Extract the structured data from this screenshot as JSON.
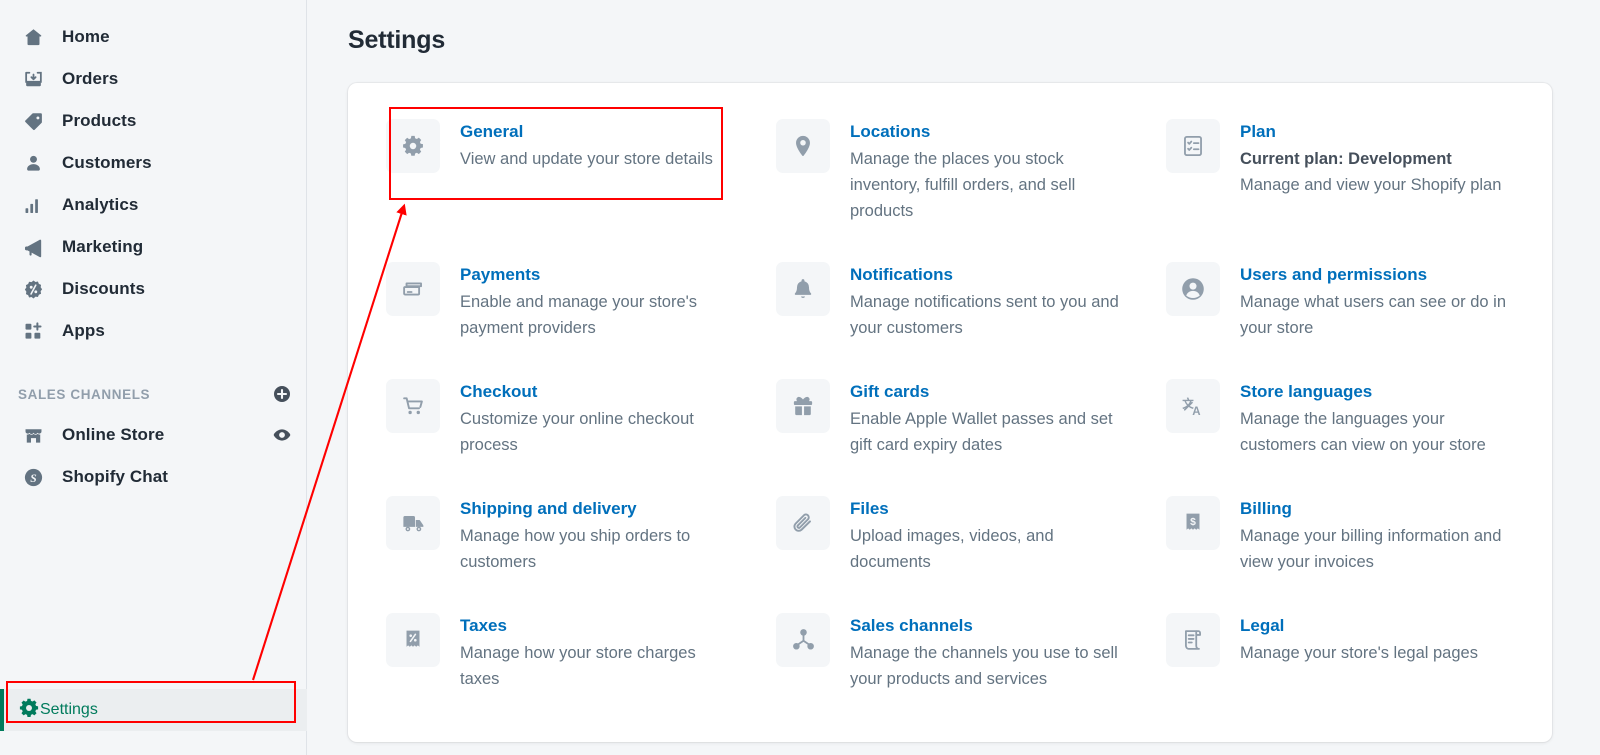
{
  "sidebar": {
    "items": [
      {
        "label": "Home",
        "icon": "home-icon"
      },
      {
        "label": "Orders",
        "icon": "orders-inbox-icon"
      },
      {
        "label": "Products",
        "icon": "product-tag-icon"
      },
      {
        "label": "Customers",
        "icon": "customer-person-icon"
      },
      {
        "label": "Analytics",
        "icon": "analytics-bars-icon"
      },
      {
        "label": "Marketing",
        "icon": "marketing-megaphone-icon"
      },
      {
        "label": "Discounts",
        "icon": "discount-percent-icon"
      },
      {
        "label": "Apps",
        "icon": "apps-grid-plus-icon"
      }
    ],
    "section": {
      "label": "SALES CHANNELS",
      "add_icon": "plus-circle-icon"
    },
    "channels": [
      {
        "label": "Online Store",
        "icon": "storefront-icon",
        "trailing_icon": "eye-icon"
      },
      {
        "label": "Shopify Chat",
        "icon": "shopify-badge-icon",
        "trailing_icon": ""
      }
    ],
    "settings": {
      "label": "Settings",
      "icon": "gear-icon",
      "active": true
    }
  },
  "main": {
    "page_title": "Settings",
    "settings_items": [
      {
        "title": "General",
        "strong": "",
        "sub": "View and update your store details",
        "icon": "gear-icon"
      },
      {
        "title": "Locations",
        "strong": "",
        "sub": "Manage the places you stock inventory, fulfill orders, and sell products",
        "icon": "location-pin-icon"
      },
      {
        "title": "Plan",
        "strong": "Current plan: Development",
        "sub": "Manage and view your Shopify plan",
        "icon": "checklist-clipboard-icon"
      },
      {
        "title": "Payments",
        "strong": "",
        "sub": "Enable and manage your store's payment providers",
        "icon": "payment-card-icon"
      },
      {
        "title": "Notifications",
        "strong": "",
        "sub": "Manage notifications sent to you and your customers",
        "icon": "bell-icon"
      },
      {
        "title": "Users and permissions",
        "strong": "",
        "sub": "Manage what users can see or do in your store",
        "icon": "user-circle-icon"
      },
      {
        "title": "Checkout",
        "strong": "",
        "sub": "Customize your online checkout process",
        "icon": "shopping-cart-icon"
      },
      {
        "title": "Gift cards",
        "strong": "",
        "sub": "Enable Apple Wallet passes and set gift card expiry dates",
        "icon": "gift-box-icon"
      },
      {
        "title": "Store languages",
        "strong": "",
        "sub": "Manage the languages your customers can view on your store",
        "icon": "language-translate-icon"
      },
      {
        "title": "Shipping and delivery",
        "strong": "",
        "sub": "Manage how you ship orders to customers",
        "icon": "delivery-truck-icon"
      },
      {
        "title": "Files",
        "strong": "",
        "sub": "Upload images, videos, and documents",
        "icon": "paperclip-icon"
      },
      {
        "title": "Billing",
        "strong": "",
        "sub": "Manage your billing information and view your invoices",
        "icon": "receipt-dollar-icon"
      },
      {
        "title": "Taxes",
        "strong": "",
        "sub": "Manage how your store charges taxes",
        "icon": "receipt-percent-icon"
      },
      {
        "title": "Sales channels",
        "strong": "",
        "sub": "Manage the channels you use to sell your products and services",
        "icon": "channels-node-icon"
      },
      {
        "title": "Legal",
        "strong": "",
        "sub": "Manage your store's legal pages",
        "icon": "legal-scroll-icon"
      }
    ]
  },
  "annotations": {
    "highlight_color": "#ff0000",
    "boxes": [
      {
        "name": "general-card-highlight"
      },
      {
        "name": "settings-nav-highlight"
      }
    ],
    "arrow": {
      "name": "pointer-arrow",
      "from": "settings-nav-highlight",
      "to": "general-card-highlight"
    }
  },
  "colors": {
    "link_blue": "#006fbb",
    "accent_green": "#007b5c",
    "text_dark": "#212b36",
    "text_muted": "#637381",
    "page_bg": "#f4f6f8"
  }
}
